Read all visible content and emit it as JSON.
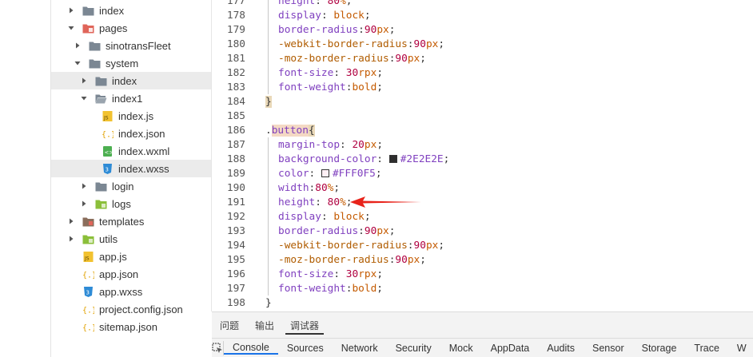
{
  "file_tree": {
    "items": [
      {
        "label": "index",
        "type": "folder",
        "expanded": false,
        "indent": 1,
        "highlighted": false,
        "icon": "folder-icon"
      },
      {
        "label": "pages",
        "type": "folder",
        "expanded": true,
        "indent": 1,
        "highlighted": false,
        "icon": "folder-red-icon"
      },
      {
        "label": "sinotransFleet",
        "type": "folder",
        "expanded": false,
        "indent": 2,
        "highlighted": false,
        "icon": "folder-icon"
      },
      {
        "label": "system",
        "type": "folder",
        "expanded": true,
        "indent": 2,
        "highlighted": false,
        "icon": "folder-icon"
      },
      {
        "label": "index",
        "type": "folder",
        "expanded": false,
        "indent": 3,
        "highlighted": true,
        "icon": "folder-icon"
      },
      {
        "label": "index1",
        "type": "folder",
        "expanded": true,
        "indent": 3,
        "highlighted": false,
        "icon": "folder-open-icon"
      },
      {
        "label": "index.js",
        "type": "file",
        "indent": 4,
        "highlighted": false,
        "icon": "js-file-icon"
      },
      {
        "label": "index.json",
        "type": "file",
        "indent": 4,
        "highlighted": false,
        "icon": "json-file-icon"
      },
      {
        "label": "index.wxml",
        "type": "file",
        "indent": 4,
        "highlighted": false,
        "icon": "wxml-file-icon"
      },
      {
        "label": "index.wxss",
        "type": "file",
        "indent": 4,
        "highlighted": true,
        "icon": "wxss-file-icon"
      },
      {
        "label": "login",
        "type": "folder",
        "expanded": false,
        "indent": 3,
        "highlighted": false,
        "icon": "folder-icon"
      },
      {
        "label": "logs",
        "type": "folder",
        "expanded": false,
        "indent": 3,
        "highlighted": false,
        "icon": "folder-green-icon"
      },
      {
        "label": "templates",
        "type": "folder",
        "expanded": false,
        "indent": 1,
        "highlighted": false,
        "icon": "folder-brown-icon"
      },
      {
        "label": "utils",
        "type": "folder",
        "expanded": false,
        "indent": 1,
        "highlighted": false,
        "icon": "folder-green-icon"
      },
      {
        "label": "app.js",
        "type": "file",
        "indent": 1,
        "highlighted": false,
        "icon": "js-file-icon"
      },
      {
        "label": "app.json",
        "type": "file",
        "indent": 1,
        "highlighted": false,
        "icon": "json-file-icon"
      },
      {
        "label": "app.wxss",
        "type": "file",
        "indent": 1,
        "highlighted": false,
        "icon": "wxss-file-icon"
      },
      {
        "label": "project.config.json",
        "type": "file",
        "indent": 1,
        "highlighted": false,
        "icon": "json-file-icon"
      },
      {
        "label": "sitemap.json",
        "type": "file",
        "indent": 1,
        "highlighted": false,
        "icon": "json-file-icon"
      }
    ]
  },
  "editor": {
    "lines": [
      {
        "num": "177",
        "text": "height: 80%;"
      },
      {
        "num": "178",
        "text": "display: block;"
      },
      {
        "num": "179",
        "text": "border-radius:90px;"
      },
      {
        "num": "180",
        "text": "-webkit-border-radius:90px;"
      },
      {
        "num": "181",
        "text": "-moz-border-radius:90px;"
      },
      {
        "num": "182",
        "text": "font-size: 30rpx;"
      },
      {
        "num": "183",
        "text": "font-weight:bold;"
      },
      {
        "num": "184",
        "text": "}"
      },
      {
        "num": "185",
        "text": ""
      },
      {
        "num": "186",
        "text": ".button{"
      },
      {
        "num": "187",
        "text": "margin-top: 20px;"
      },
      {
        "num": "188",
        "text": "background-color: #2E2E2E;"
      },
      {
        "num": "189",
        "text": "color: #FFF0F5;"
      },
      {
        "num": "190",
        "text": "width:80%;"
      },
      {
        "num": "191",
        "text": "height: 80%;"
      },
      {
        "num": "192",
        "text": "display: block;"
      },
      {
        "num": "193",
        "text": "border-radius:90px;"
      },
      {
        "num": "194",
        "text": "-webkit-border-radius:90px;"
      },
      {
        "num": "195",
        "text": "-moz-border-radius:90px;"
      },
      {
        "num": "196",
        "text": "font-size: 30rpx;"
      },
      {
        "num": "197",
        "text": "font-weight:bold;"
      },
      {
        "num": "198",
        "text": "}"
      }
    ],
    "swatch_colors": {
      "bg": "#2E2E2E",
      "fg": "#FFF0F5"
    },
    "annotation": {
      "target_line": "191",
      "color": "#e8231a"
    }
  },
  "bottom_panel": {
    "tabs": [
      {
        "label": "问题",
        "active": false
      },
      {
        "label": "输出",
        "active": false
      },
      {
        "label": "调试器",
        "active": true
      }
    ],
    "devtools_tabs": [
      {
        "label": "Console",
        "active": true
      },
      {
        "label": "Sources",
        "active": false
      },
      {
        "label": "Network",
        "active": false
      },
      {
        "label": "Security",
        "active": false
      },
      {
        "label": "Mock",
        "active": false
      },
      {
        "label": "AppData",
        "active": false
      },
      {
        "label": "Audits",
        "active": false
      },
      {
        "label": "Sensor",
        "active": false
      },
      {
        "label": "Storage",
        "active": false
      },
      {
        "label": "Trace",
        "active": false
      },
      {
        "label": "W",
        "active": false
      }
    ]
  }
}
